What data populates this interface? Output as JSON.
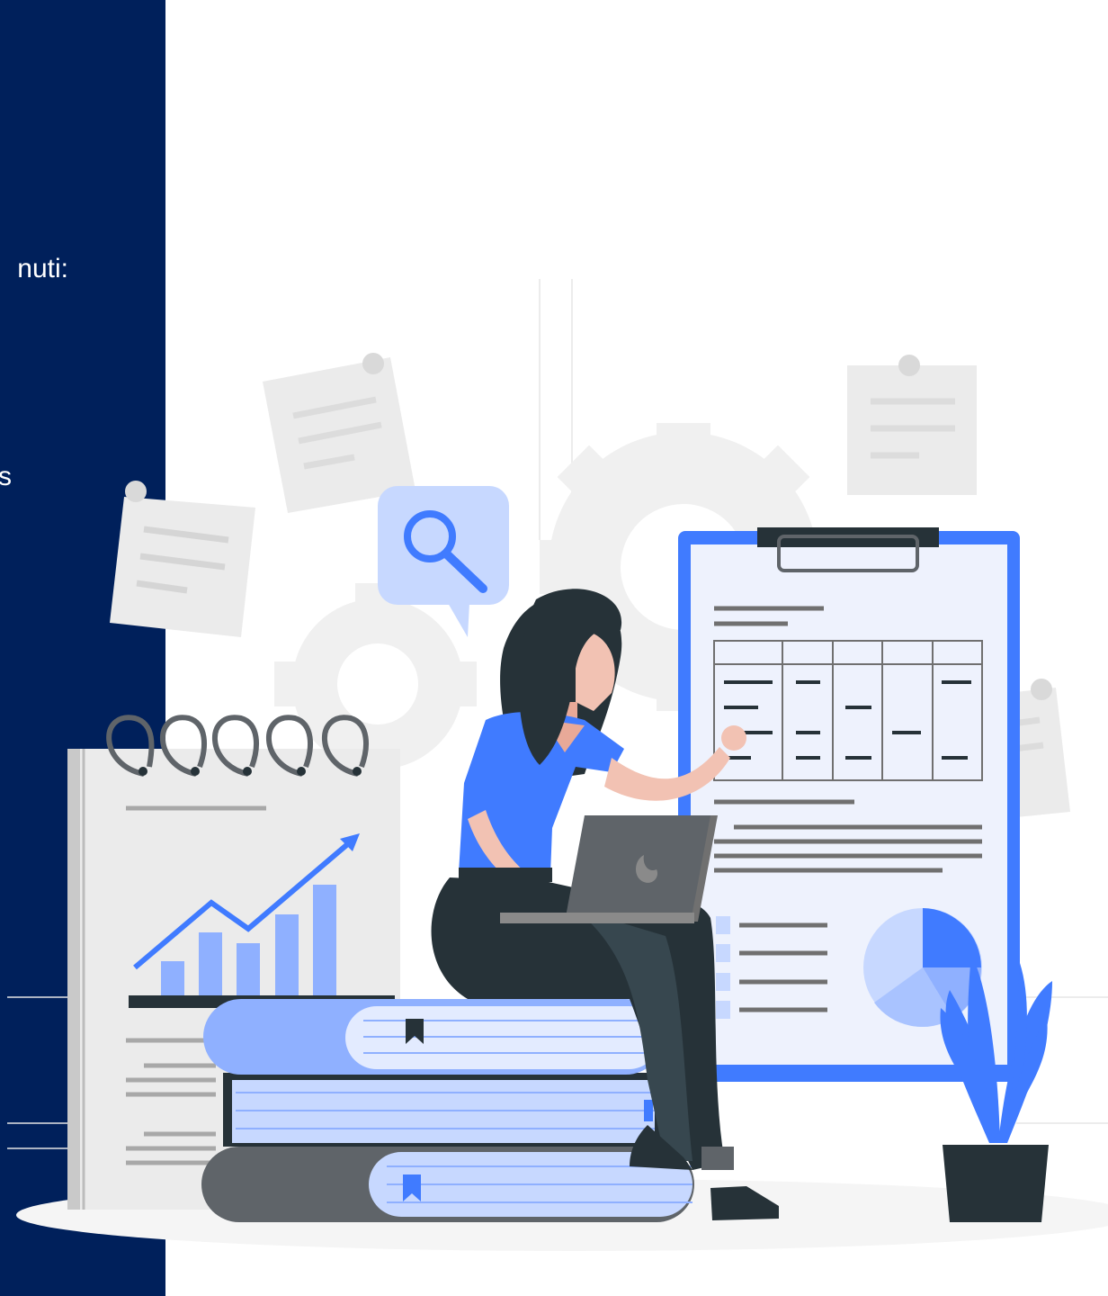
{
  "colors": {
    "panel": "#00205b",
    "accent_blue": "#407bff",
    "light_blue": "#c7d8ff",
    "dark": "#263238",
    "gray": "#ebebeb"
  },
  "panel": {
    "line1": "nuti:",
    "line2": "s"
  },
  "illustration": {
    "scene": "illustration-woman-laptop-books-clipboard",
    "icons": [
      "magnifier-icon",
      "gear-icon",
      "pie-chart-icon",
      "bar-chart-icon",
      "plant-icon",
      "bookmark-icon"
    ]
  }
}
